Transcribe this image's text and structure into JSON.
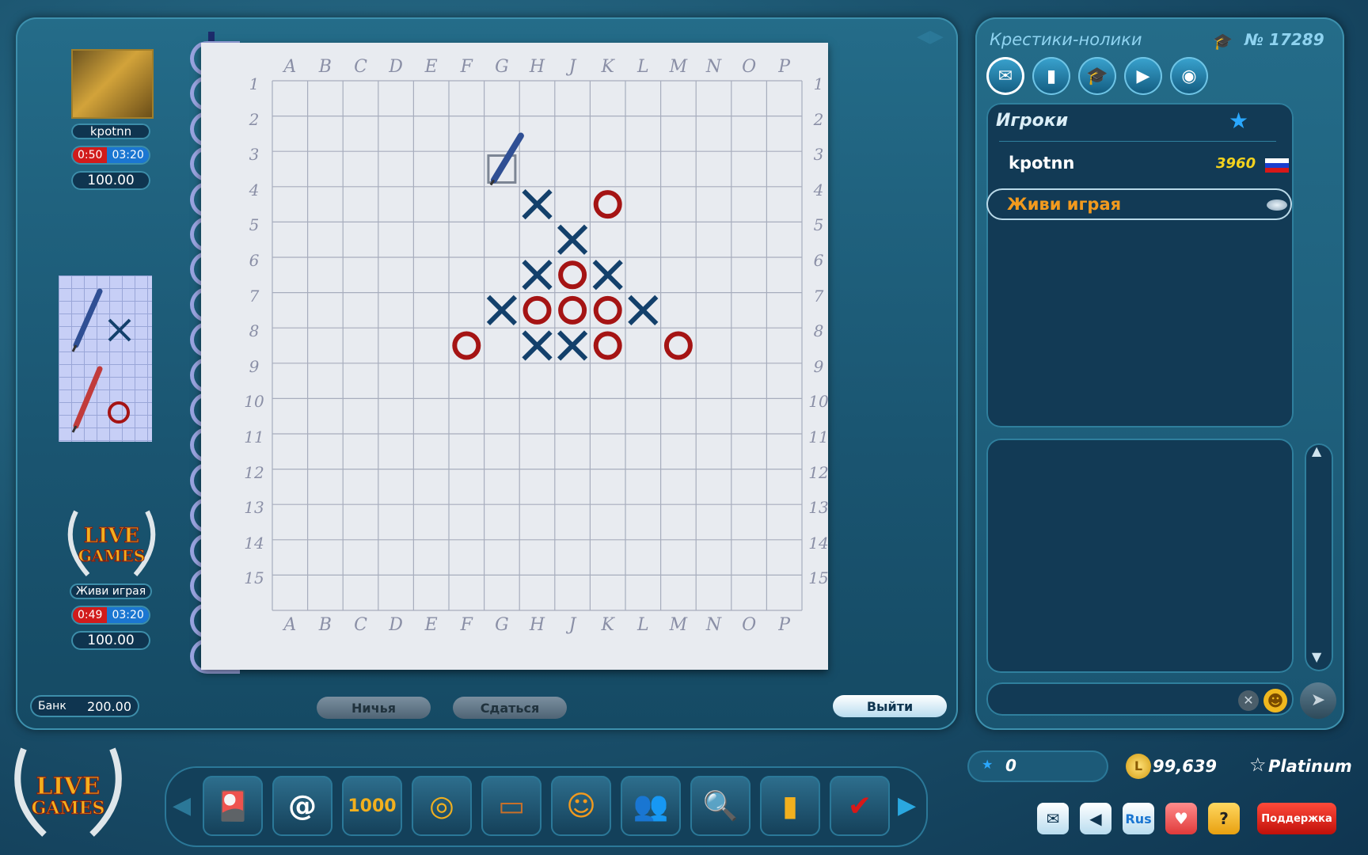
{
  "game": {
    "title": "Крестики-нолики",
    "number": "№ 17289"
  },
  "columns": [
    "A",
    "B",
    "C",
    "D",
    "E",
    "F",
    "G",
    "H",
    "J",
    "K",
    "L",
    "M",
    "N",
    "O",
    "P"
  ],
  "rows": [
    "1",
    "2",
    "3",
    "4",
    "5",
    "6",
    "7",
    "8",
    "9",
    "10",
    "11",
    "12",
    "13",
    "14",
    "15"
  ],
  "board": {
    "x_moves": [
      [
        "H",
        4
      ],
      [
        "J",
        5
      ],
      [
        "H",
        6
      ],
      [
        "K",
        6
      ],
      [
        "G",
        7
      ],
      [
        "L",
        7
      ],
      [
        "H",
        8
      ],
      [
        "J",
        8
      ]
    ],
    "o_moves": [
      [
        "K",
        4
      ],
      [
        "J",
        6
      ],
      [
        "H",
        7
      ],
      [
        "J",
        7
      ],
      [
        "K",
        7
      ],
      [
        "F",
        8
      ],
      [
        "K",
        8
      ],
      [
        "M",
        8
      ]
    ],
    "cursor": [
      "G",
      3
    ],
    "x_color": "#13406b",
    "o_color": "#a51414"
  },
  "player1": {
    "name": "kpotnn",
    "time_red": "0:50",
    "time_blue": "03:20",
    "bet": "100.00"
  },
  "player2": {
    "name": "Живи играя",
    "time_red": "0:49",
    "time_blue": "03:20",
    "bet": "100.00"
  },
  "bank": {
    "label": "Банк",
    "value": "200.00"
  },
  "buttons": {
    "draw": "Ничья",
    "surrender": "Сдаться",
    "exit": "Выйти"
  },
  "players_panel": {
    "title": "Игроки",
    "list": [
      {
        "name": "kpotnn",
        "rating": "3960",
        "flag": "russia-flag-icon"
      },
      {
        "name": "Живи играя",
        "rating": "",
        "flag": "globe-icon"
      }
    ]
  },
  "status_bar": {
    "stars": "0",
    "coins": "99,639",
    "level": "Platinum"
  },
  "lang_button": "Rus",
  "support_button": "Поддержка",
  "logo_text": {
    "line1": "LIVE",
    "line2": "GAMES"
  },
  "colors": {
    "accent": "#1b76d1",
    "danger": "#d11b1b",
    "gold": "#e8b61a"
  }
}
